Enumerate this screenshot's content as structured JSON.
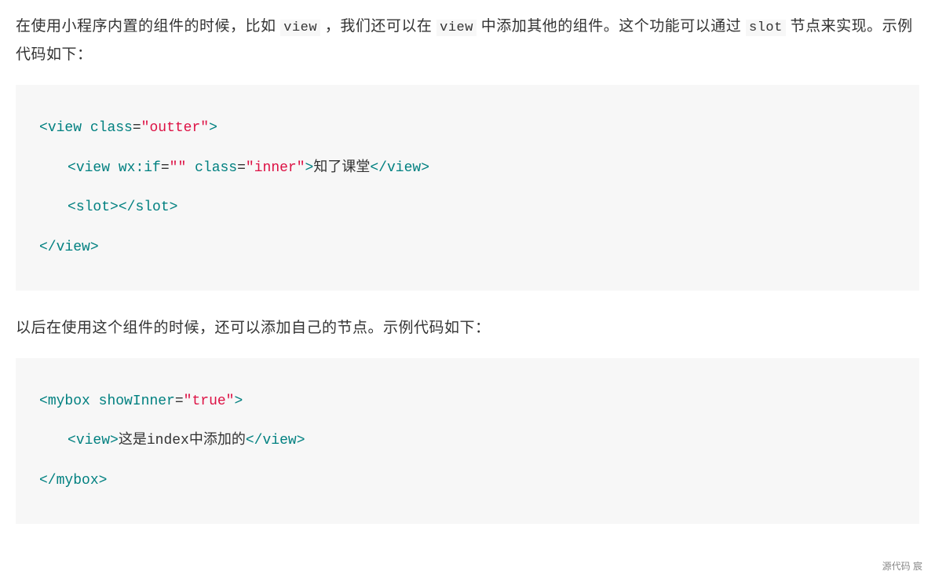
{
  "para1": {
    "seg1": "在使用小程序内置的组件的时候，比如 ",
    "code1": "view",
    "seg2": " ，我们还可以在 ",
    "code2": "view",
    "seg3": " 中添加其他的组件。这个功能可以通过 ",
    "code3": "slot",
    "seg4": " 节点来实现。示例代码如下："
  },
  "code1": {
    "l1_open": "<",
    "l1_tag": "view",
    "l1_sp": " ",
    "l1_attr": "class",
    "l1_eq": "=",
    "l1_val": "\"outter\"",
    "l1_close": ">",
    "l2_open": "<",
    "l2_tag": "view",
    "l2_sp1": " ",
    "l2_attr1": "wx:if",
    "l2_eq1": "=",
    "l2_val1": "\"\"",
    "l2_sp2": " ",
    "l2_attr2": "class",
    "l2_eq2": "=",
    "l2_val2": "\"inner\"",
    "l2_close1": ">",
    "l2_text": "知了课堂",
    "l2_close2": "</",
    "l2_tag2": "view",
    "l2_close3": ">",
    "l3_open": "<",
    "l3_tag": "slot",
    "l3_close1": ">",
    "l3_close2": "</",
    "l3_tag2": "slot",
    "l3_close3": ">",
    "l4_open": "</",
    "l4_tag": "view",
    "l4_close": ">"
  },
  "para2": "以后在使用这个组件的时候，还可以添加自己的节点。示例代码如下：",
  "code2": {
    "l1_open": "<",
    "l1_tag": "mybox",
    "l1_sp": " ",
    "l1_attr": "showInner",
    "l1_eq": "=",
    "l1_val": "\"true\"",
    "l1_close": ">",
    "l2_open": "<",
    "l2_tag": "view",
    "l2_close1": ">",
    "l2_text": "这是index中添加的",
    "l2_close2": "</",
    "l2_tag2": "view",
    "l2_close3": ">",
    "l3_open": "</",
    "l3_tag": "mybox",
    "l3_close": ">"
  },
  "footer": "源代码  宸"
}
